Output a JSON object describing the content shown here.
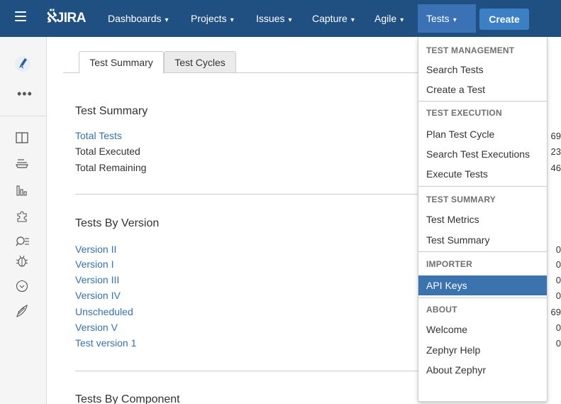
{
  "nav": {
    "logo": "JIRA",
    "items": [
      {
        "label": "Dashboards"
      },
      {
        "label": "Projects"
      },
      {
        "label": "Issues"
      },
      {
        "label": "Capture"
      },
      {
        "label": "Agile"
      },
      {
        "label": "Tests"
      }
    ],
    "create_label": "Create"
  },
  "tabs": [
    {
      "label": "Test Summary"
    },
    {
      "label": "Test Cycles"
    }
  ],
  "summary": {
    "title": "Test Summary",
    "rows": [
      {
        "label": "Total Tests",
        "value": "69"
      },
      {
        "label": "Total Executed",
        "value": "23"
      },
      {
        "label": "Total Remaining",
        "value": "46"
      }
    ]
  },
  "by_version": {
    "title": "Tests By Version",
    "rows": [
      {
        "label": "Version II",
        "value": "0"
      },
      {
        "label": "Version I",
        "value": "0"
      },
      {
        "label": "Version III",
        "value": "0"
      },
      {
        "label": "Version IV",
        "value": "0"
      },
      {
        "label": "Unscheduled",
        "value": "69"
      },
      {
        "label": "Version V",
        "value": "0"
      },
      {
        "label": "Test version 1",
        "value": "0"
      }
    ]
  },
  "by_component": {
    "title": "Tests By Component"
  },
  "menu": {
    "sections": [
      {
        "header": "TEST MANAGEMENT",
        "items": [
          "Search Tests",
          "Create a Test"
        ]
      },
      {
        "header": "TEST EXECUTION",
        "items": [
          "Plan Test Cycle",
          "Search Test Executions",
          "Execute Tests"
        ]
      },
      {
        "header": "TEST SUMMARY",
        "items": [
          "Test Metrics",
          "Test Summary"
        ]
      },
      {
        "header": "IMPORTER",
        "items": [
          "API Keys"
        ]
      },
      {
        "header": "ABOUT",
        "items": [
          "Welcome",
          "Zephyr Help",
          "About Zephyr"
        ]
      }
    ]
  },
  "colors": {
    "topbar": "#205081",
    "link": "#3572b0",
    "active_item": "#3b73af"
  }
}
